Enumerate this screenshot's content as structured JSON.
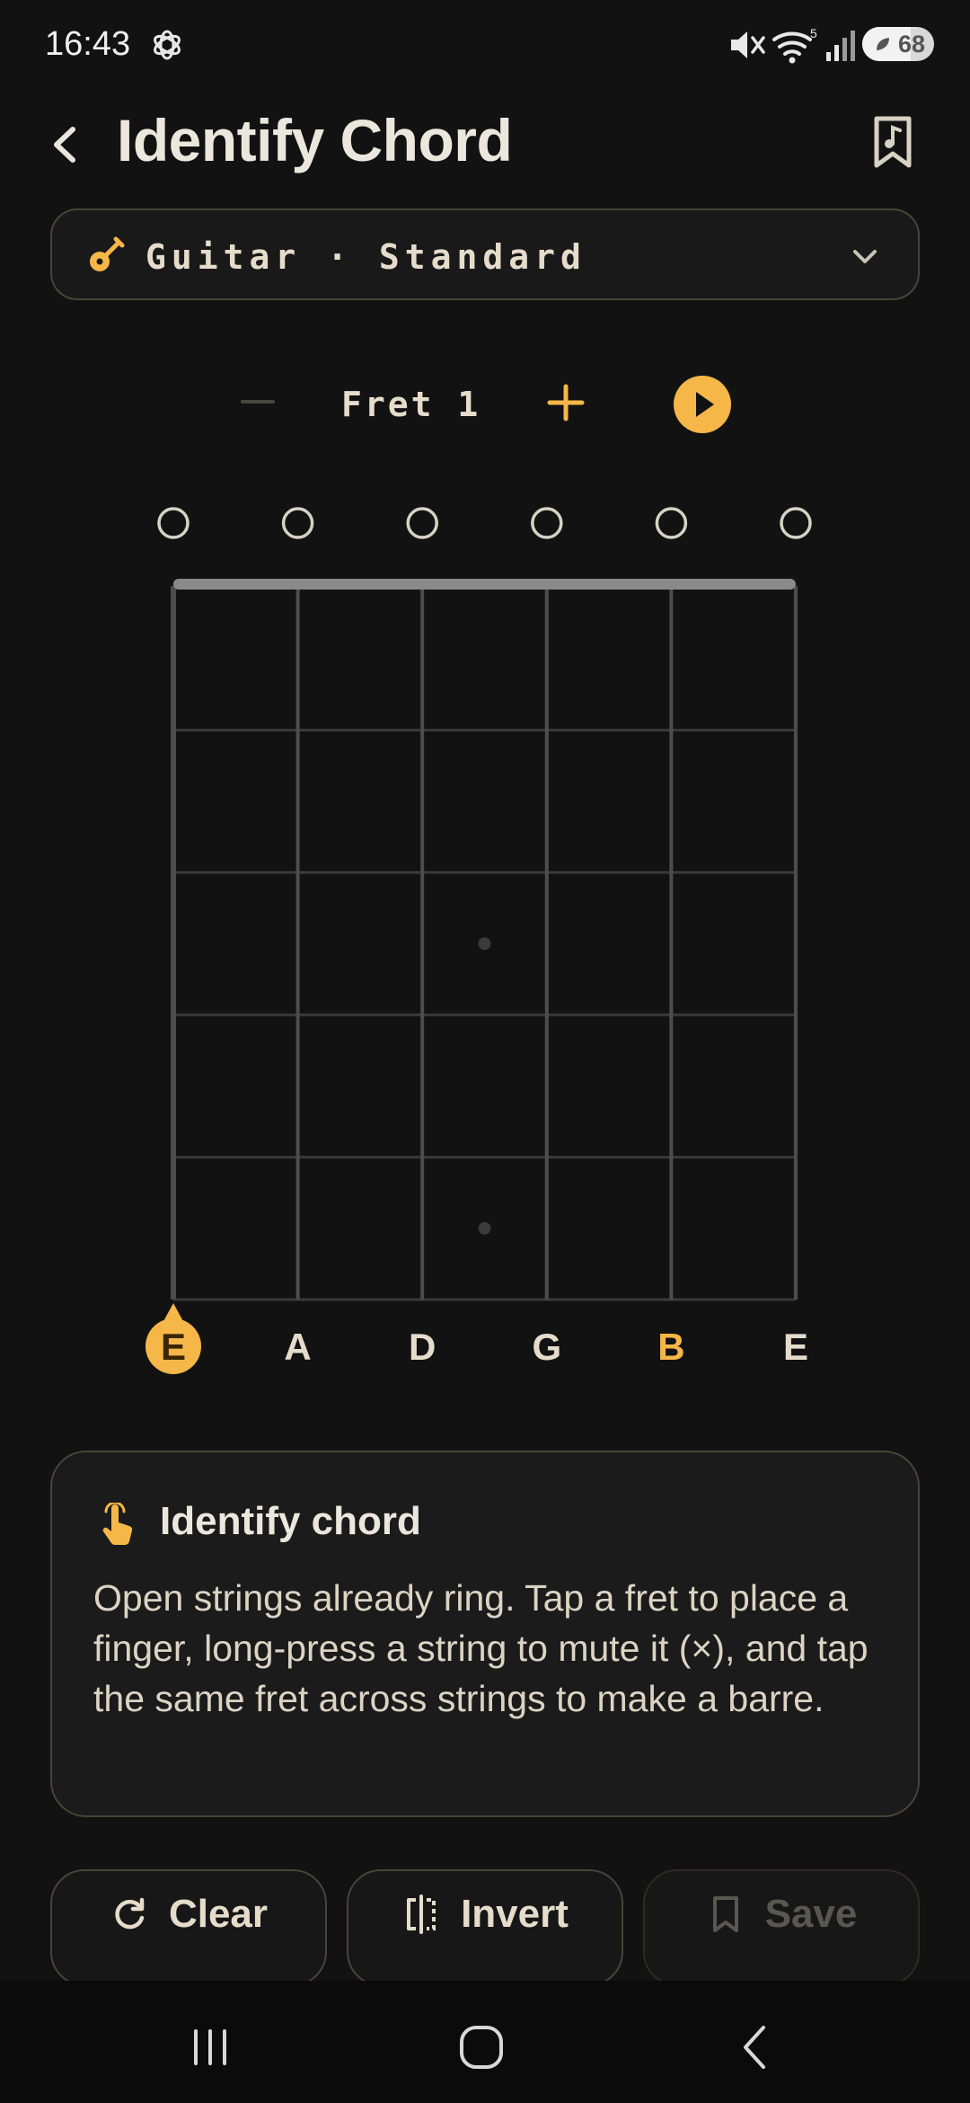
{
  "status_bar": {
    "time": "16:43",
    "battery_level": "68",
    "wifi_badge": "5"
  },
  "header": {
    "title": "Identify Chord"
  },
  "instrument_selector": {
    "label": "Guitar · Standard"
  },
  "fret_controls": {
    "fret_label": "Fret 1"
  },
  "fretboard": {
    "string_count": 6,
    "fret_rows": 5,
    "open_markers": [
      "○",
      "○",
      "○",
      "○",
      "○",
      "○"
    ],
    "string_labels": [
      "E",
      "A",
      "D",
      "G",
      "B",
      "E"
    ],
    "highlighted_strings": [
      0,
      4
    ],
    "selected_string": 0,
    "inlay_frets": [
      3,
      5
    ]
  },
  "info_card": {
    "title": "Identify chord",
    "body": "Open strings already ring. Tap a fret to place a finger, long-press a string to mute it (×), and tap the same fret across strings to make a barre."
  },
  "actions": {
    "clear_label": "Clear",
    "invert_label": "Invert",
    "save_label": "Save"
  },
  "colors": {
    "accent": "#f5b748",
    "background": "#121212",
    "border": "#4a4336",
    "text": "#e6dccb"
  },
  "icons": {
    "back": "chevron-left-icon",
    "library": "music-bookmark-icon",
    "instrument": "guitar-icon",
    "dropdown": "chevron-down-icon",
    "play": "play-icon",
    "tip": "tap-finger-icon",
    "clear": "refresh-icon",
    "invert": "mirror-icon",
    "save": "bookmark-icon"
  }
}
